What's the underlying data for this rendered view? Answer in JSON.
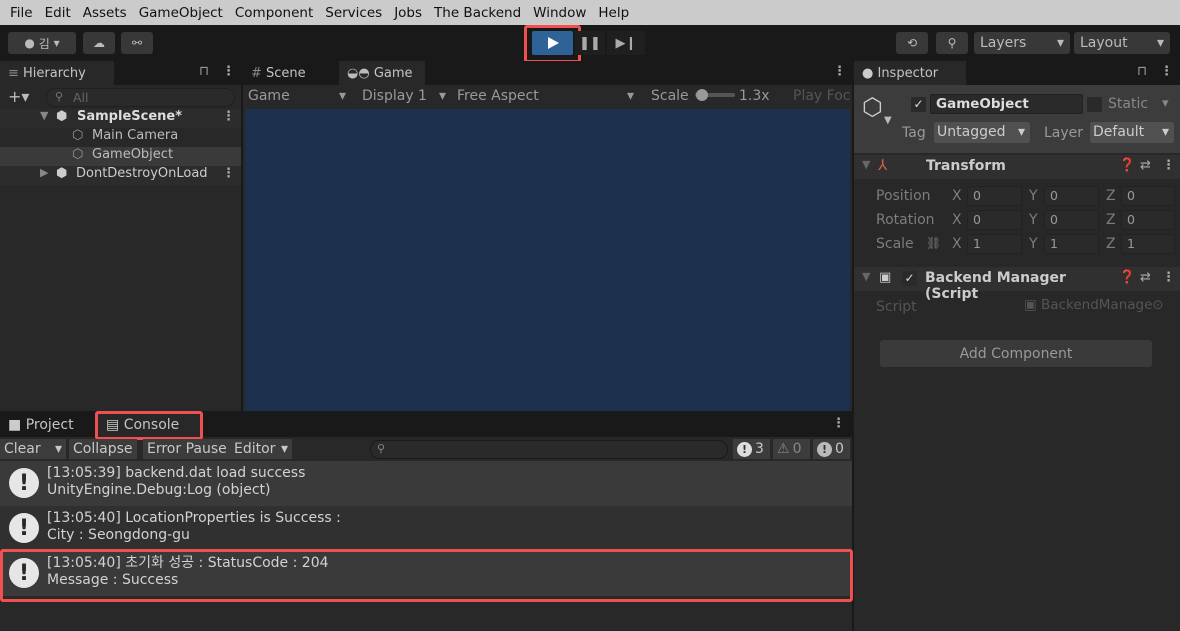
{
  "menu": [
    "File",
    "Edit",
    "Assets",
    "GameObject",
    "Component",
    "Services",
    "Jobs",
    "The Backend",
    "Window",
    "Help"
  ],
  "toolbar": {
    "account": "김",
    "layers": "Layers",
    "layout": "Layout"
  },
  "hierarchy": {
    "tab": "Hierarchy",
    "search_placeholder": "All",
    "items": [
      "SampleScene*",
      "Main Camera",
      "GameObject",
      "DontDestroyOnLoad"
    ]
  },
  "scene_tabs": [
    "Scene",
    "Game"
  ],
  "game_bar": {
    "mode": "Game",
    "display": "Display 1",
    "aspect": "Free Aspect",
    "scale_label": "Scale",
    "scale_value": "1.3x",
    "play_focused": "Play Foc"
  },
  "bottom_tabs": [
    "Project",
    "Console"
  ],
  "console": {
    "clear": "Clear",
    "collapse": "Collapse",
    "error_pause": "Error Pause",
    "editor": "Editor",
    "count_log": "3",
    "count_warn": "0",
    "count_err": "0",
    "logs": [
      {
        "line1": "[13:05:39] backend.dat load success",
        "line2": "UnityEngine.Debug:Log (object)"
      },
      {
        "line1": "[13:05:40] LocationProperties is Success :",
        "line2": "City : Seongdong-gu"
      },
      {
        "line1": "[13:05:40] 초기화 성공 : StatusCode : 204",
        "line2": "Message : Success"
      }
    ]
  },
  "inspector": {
    "tab": "Inspector",
    "name": "GameObject",
    "static": "Static",
    "tag_label": "Tag",
    "tag": "Untagged",
    "layer_label": "Layer",
    "layer": "Default",
    "transform": "Transform",
    "position": "Position",
    "rotation": "Rotation",
    "scale": "Scale",
    "pos": [
      "0",
      "0",
      "0"
    ],
    "rot": [
      "0",
      "0",
      "0"
    ],
    "scl": [
      "1",
      "1",
      "1"
    ],
    "axes": [
      "X",
      "Y",
      "Z"
    ],
    "component": "Backend Manager (Script",
    "script_label": "Script",
    "script_value": "BackendManage",
    "add_component": "Add Component"
  },
  "colors": {
    "accent": "#2f6296",
    "highlight": "#f05050",
    "game_view": "#1c314d"
  }
}
